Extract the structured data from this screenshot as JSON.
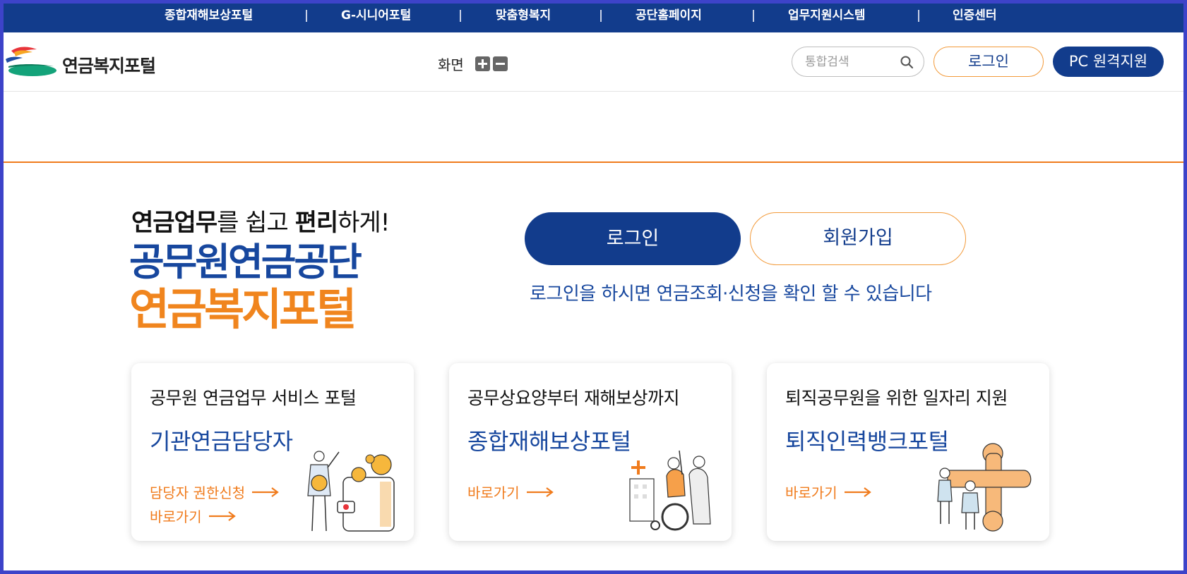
{
  "topnav": {
    "items": [
      "종합재해보상포털",
      "G-시니어포털",
      "맞춤형복지",
      "공단홈페이지",
      "업무지원시스템",
      "인증센터"
    ]
  },
  "header": {
    "logo_text": "연금복지포털",
    "zoom_label": "화면",
    "search_placeholder": "통합검색",
    "login_label": "로그인",
    "pc_support_label": "PC 원격지원"
  },
  "hero": {
    "tagline_bold1": "연금업무",
    "tagline_mid": "를 쉽고 ",
    "tagline_bold2": "편리",
    "tagline_end": "하게!",
    "brand_line1": "공무원연금공단",
    "brand_line2": "연금복지포털",
    "login_button": "로그인",
    "signup_button": "회원가입",
    "login_note": "로그인을 하시면 연금조회·신청을 확인 할 수 있습니다"
  },
  "cards": [
    {
      "subtitle": "공무원 연금업무 서비스 포털",
      "title": "기관연금담당자",
      "link1": "담당자 권한신청",
      "link2": "바로가기"
    },
    {
      "subtitle": "공무상요양부터 재해보상까지",
      "title": "종합재해보상포털",
      "link1": "바로가기"
    },
    {
      "subtitle": "퇴직공무원을 위한 일자리 지원",
      "title": "퇴직인력뱅크포털",
      "link1": "바로가기"
    }
  ],
  "colors": {
    "primary": "#123c8c",
    "accent": "#f07b1c",
    "border": "#3d43c9"
  }
}
